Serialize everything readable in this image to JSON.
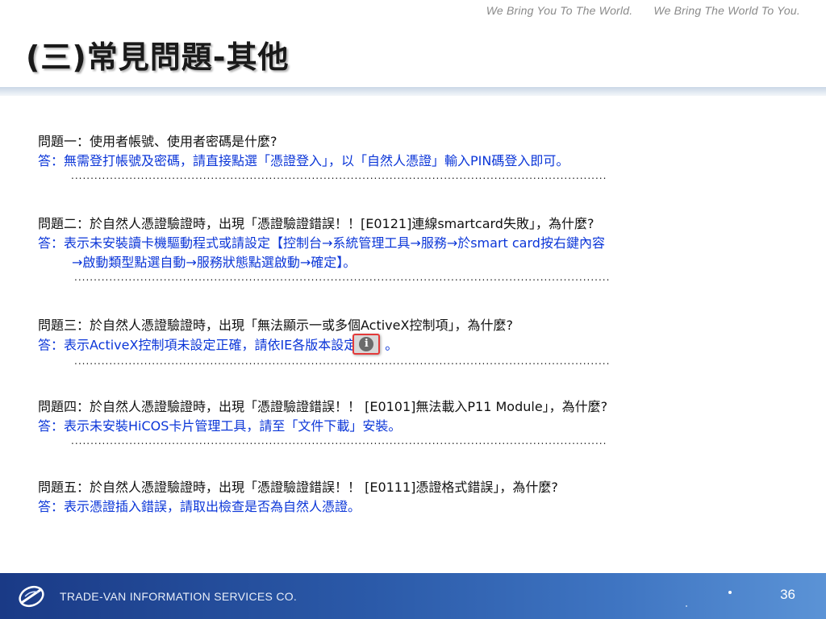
{
  "header": {
    "slogan_1": "We Bring You To The World.",
    "slogan_2": "We Bring The World To You.",
    "title": "(三)常見問題-其他"
  },
  "qa": [
    {
      "question": "問題一：使用者帳號、使用者密碼是什麼?",
      "answer": "答：無需登打帳號及密碼，請直接點選「憑證登入」，以「自然人憑證」輸入PIN碼登入即可。"
    },
    {
      "question": "問題二：於自然人憑證驗證時，出現「憑證驗證錯誤！！[E0121]連線smartcard失敗」，為什麼?",
      "answer": "答：表示未安裝讀卡機驅動程式或請設定【控制台→系統管理工具→服務→於smart card按右鍵內容",
      "answer_cont": "→啟動類型點選自動→服務狀態點選啟動→確定】。"
    },
    {
      "question": "問題三：於自然人憑證驗證時，出現「無法顯示一或多個ActiveX控制項」，為什麼?",
      "answer": "答：表示ActiveX控制項未設定正確，請依IE各版本設定",
      "answer_end": "。",
      "icon": "info-icon"
    },
    {
      "question": "問題四：於自然人憑證驗證時，出現「憑證驗證錯誤！！ [E0101]無法載入P11 Module」，為什麼?",
      "answer": "答：表示未安裝HiCOS卡片管理工具，請至「文件下載」安裝。"
    },
    {
      "question": "問題五：於自然人憑證驗證時，出現「憑證驗證錯誤！！ [E0111]憑證格式錯誤」，為什麼?",
      "answer": "答：表示憑證插入錯誤，請取出檢查是否為自然人憑證。"
    }
  ],
  "separator": "..........................................................................................................................................",
  "footer": {
    "company": "TRADE-VAN INFORMATION SERVICES CO.",
    "page_number": "36",
    "logo_icon": "trade-van-logo-icon"
  },
  "colors": {
    "question": "#111111",
    "answer": "#0b36d8",
    "footer_start": "#1a3a86",
    "footer_end": "#5b93d6"
  }
}
